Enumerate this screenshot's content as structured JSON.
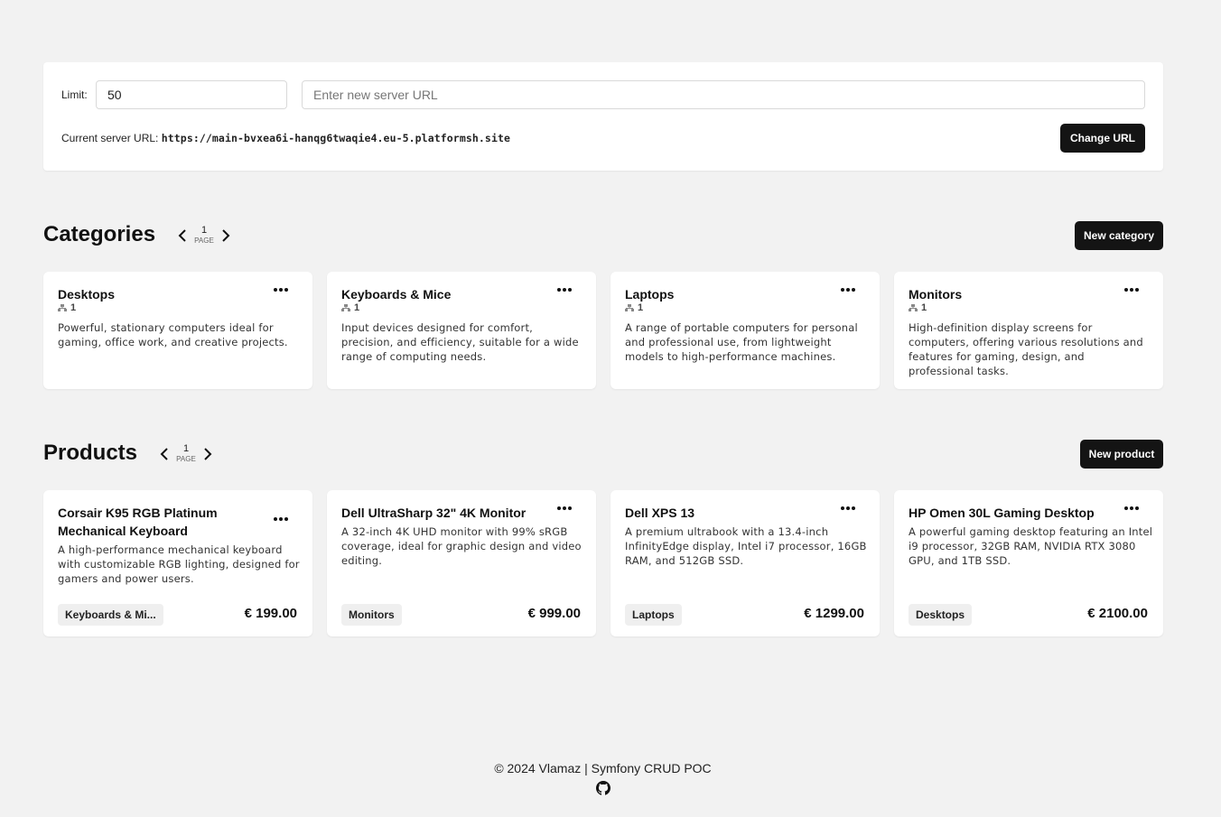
{
  "settings": {
    "limit_label": "Limit:",
    "limit_value": "50",
    "url_placeholder": "Enter new server URL",
    "current_url_label": "Current server URL:",
    "current_url_value": "https://main-bvxea6i-hanqg6twaqie4.eu-5.platformsh.site",
    "change_url_label": "Change URL"
  },
  "categories": {
    "title": "Categories",
    "page_number": "1",
    "page_label": "PAGE",
    "new_label": "New category",
    "items": [
      {
        "name": "Desktops",
        "count": "1",
        "description": "Powerful, stationary computers ideal for gaming, office work, and creative projects."
      },
      {
        "name": "Keyboards & Mice",
        "count": "1",
        "description": "Input devices designed for comfort, precision, and efficiency, suitable for a wide range of computing needs."
      },
      {
        "name": "Laptops",
        "count": "1",
        "description": "A range of portable computers for personal and professional use, from lightweight models to high-performance machines."
      },
      {
        "name": "Monitors",
        "count": "1",
        "description": "High-definition display screens for computers, offering various resolutions and features for gaming, design, and professional tasks."
      }
    ]
  },
  "products": {
    "title": "Products",
    "page_number": "1",
    "page_label": "PAGE",
    "new_label": "New product",
    "items": [
      {
        "name": "Corsair K95 RGB Platinum Mechanical Keyboard",
        "description": "A high-performance mechanical keyboard with customizable RGB lighting, designed for gamers and power users.",
        "category": "Keyboards & Mi...",
        "price": "€ 199.00"
      },
      {
        "name": "Dell UltraSharp 32\" 4K Monitor",
        "description": "A 32-inch 4K UHD monitor with 99% sRGB coverage, ideal for graphic design and video editing.",
        "category": "Monitors",
        "price": "€ 999.00"
      },
      {
        "name": "Dell XPS 13",
        "description": "A premium ultrabook with a 13.4-inch InfinityEdge display, Intel i7 processor, 16GB RAM, and 512GB SSD.",
        "category": "Laptops",
        "price": "€ 1299.00"
      },
      {
        "name": "HP Omen 30L Gaming Desktop",
        "description": "A powerful gaming desktop featuring an Intel i9 processor, 32GB RAM, NVIDIA RTX 3080 GPU, and 1TB SSD.",
        "category": "Desktops",
        "price": "€ 2100.00"
      }
    ]
  },
  "footer": {
    "text": "© 2024 Vlamaz | Symfony CRUD POC",
    "github_icon": "github-icon"
  }
}
